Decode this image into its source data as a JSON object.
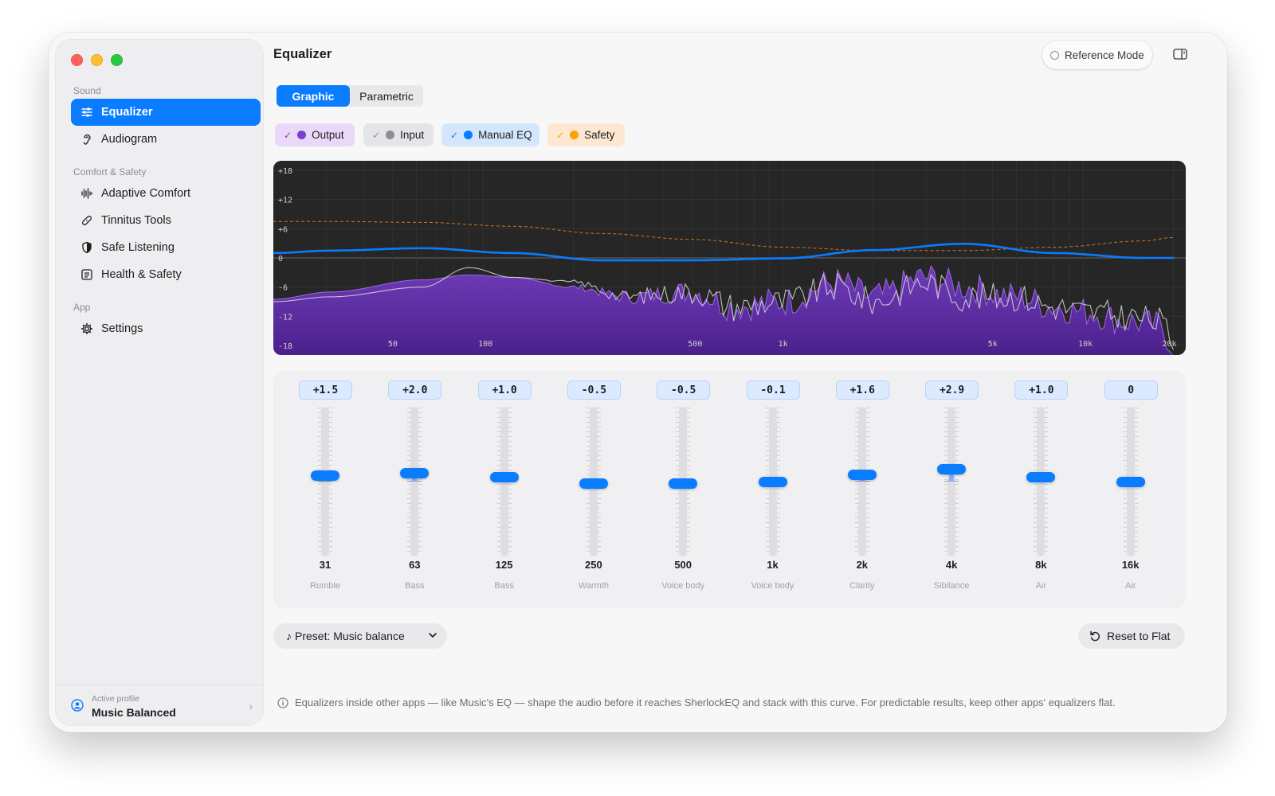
{
  "sidebar": {
    "sections": [
      {
        "label": "Sound",
        "items": [
          {
            "label": "Equalizer",
            "icon": "sliders-icon",
            "active": true
          },
          {
            "label": "Audiogram",
            "icon": "ear-icon"
          }
        ]
      },
      {
        "label": "Comfort & Safety",
        "items": [
          {
            "label": "Adaptive Comfort",
            "icon": "waveform-icon"
          },
          {
            "label": "Tinnitus Tools",
            "icon": "bandage-icon"
          },
          {
            "label": "Safe Listening",
            "icon": "shield-icon"
          },
          {
            "label": "Health & Safety",
            "icon": "list-icon"
          }
        ]
      },
      {
        "label": "App",
        "items": [
          {
            "label": "Settings",
            "icon": "gear-icon"
          }
        ]
      }
    ],
    "profile": {
      "caption": "Active profile",
      "name": "Music Balanced"
    }
  },
  "header": {
    "title": "Equalizer",
    "reference_mode": "Reference Mode"
  },
  "tabs": [
    {
      "label": "Graphic",
      "selected": true
    },
    {
      "label": "Parametric",
      "selected": false
    }
  ],
  "chips": [
    {
      "label": "Output",
      "checked": true,
      "dot": "#7b3fd0",
      "bg": "#e9d8f7",
      "check": "#7b3fd0"
    },
    {
      "label": "Input",
      "checked": true,
      "dot": "#8e8e93",
      "bg": "#e5e5e8",
      "check": "#8e8e93"
    },
    {
      "label": "Manual EQ",
      "checked": true,
      "dot": "#0a7cff",
      "bg": "#d4e6fd",
      "check": "#0a7cff"
    },
    {
      "label": "Safety",
      "checked": true,
      "dot": "#ff9f0a",
      "bg": "#fde7d0",
      "check": "#ff9f0a"
    }
  ],
  "chart_data": {
    "type": "line",
    "y_ticks": [
      "+18",
      "+12",
      "+6",
      "0",
      "-6",
      "-12",
      "-18"
    ],
    "y_range": [
      -18,
      18
    ],
    "x_ticks": [
      "50",
      "100",
      "500",
      "1k",
      "5k",
      "10k",
      "20k"
    ],
    "x_scale": "log",
    "series": [
      {
        "name": "Manual EQ",
        "color": "#0a7cff",
        "x": [
          20,
          31,
          63,
          125,
          250,
          500,
          1000,
          2000,
          4000,
          8000,
          16000,
          20000
        ],
        "y": [
          1.0,
          1.5,
          2.0,
          1.0,
          -0.5,
          -0.5,
          -0.1,
          1.6,
          2.9,
          1.0,
          0,
          0
        ]
      },
      {
        "name": "Safety",
        "color": "#ff9f0a",
        "dashed": true,
        "x": [
          20,
          31,
          63,
          125,
          250,
          500,
          1000,
          2000,
          4000,
          8000,
          16000,
          20000
        ],
        "y": [
          7.5,
          7.5,
          7.3,
          6.5,
          5.0,
          3.8,
          2.2,
          1.5,
          1.5,
          2.2,
          3.5,
          4.2
        ]
      },
      {
        "name": "Input",
        "color": "#bfbfbf",
        "x": [
          20,
          31,
          63,
          90,
          125,
          200,
          300,
          500,
          700,
          1000,
          1500,
          2000,
          3000,
          4000,
          6000,
          8000,
          10000,
          14000,
          18000,
          20000
        ],
        "y": [
          -9,
          -8,
          -6,
          -2,
          -4,
          -5,
          -8,
          -7,
          -10,
          -9,
          -6,
          -9,
          -5,
          -8,
          -8,
          -10,
          -11,
          -12,
          -13,
          -17
        ]
      },
      {
        "name": "Output",
        "color": "#7b3fd0",
        "x": [
          20,
          31,
          63,
          90,
          125,
          200,
          300,
          500,
          700,
          1000,
          1500,
          2000,
          3000,
          4000,
          6000,
          8000,
          10000,
          14000,
          18000,
          20000
        ],
        "y": [
          -8.5,
          -7,
          -4.5,
          -3.5,
          -4,
          -6,
          -8,
          -7,
          -10,
          -9,
          -5,
          -8,
          -4,
          -6,
          -8,
          -10,
          -11,
          -13,
          -14,
          -18
        ]
      }
    ]
  },
  "bands": [
    {
      "value": "+1.5",
      "gain": 1.5,
      "freq": "31",
      "label": "Rumble"
    },
    {
      "value": "+2.0",
      "gain": 2.0,
      "freq": "63",
      "label": "Bass"
    },
    {
      "value": "+1.0",
      "gain": 1.0,
      "freq": "125",
      "label": "Bass"
    },
    {
      "value": "-0.5",
      "gain": -0.5,
      "freq": "250",
      "label": "Warmth"
    },
    {
      "value": "-0.5",
      "gain": -0.5,
      "freq": "500",
      "label": "Voice body"
    },
    {
      "value": "-0.1",
      "gain": -0.1,
      "freq": "1k",
      "label": "Voice body"
    },
    {
      "value": "+1.6",
      "gain": 1.6,
      "freq": "2k",
      "label": "Clarity"
    },
    {
      "value": "+2.9",
      "gain": 2.9,
      "freq": "4k",
      "label": "Sibilance"
    },
    {
      "value": "+1.0",
      "gain": 1.0,
      "freq": "8k",
      "label": "Air"
    },
    {
      "value": "0",
      "gain": 0,
      "freq": "16k",
      "label": "Air"
    }
  ],
  "footer": {
    "preset": "Preset: Music balance",
    "reset": "Reset to Flat",
    "info": "Equalizers inside other apps — like Music's EQ — shape the audio before it reaches SherlockEQ and stack with this curve. For predictable results, keep other apps' equalizers flat."
  },
  "colors": {
    "accent": "#0a7cff",
    "output": "#7b3fd0",
    "safety": "#ff9f0a"
  }
}
